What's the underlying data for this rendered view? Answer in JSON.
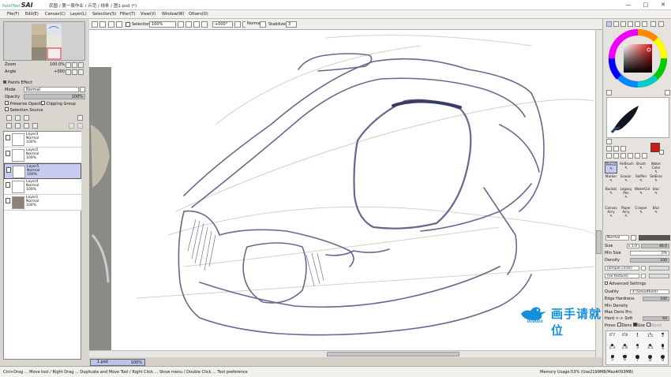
{
  "app": {
    "logo_prefix": "PaintTool",
    "logo_name": "SAI",
    "document_title": "农圆 / 第一周作业 / 示范 / 线条 / 图1.psd (*)"
  },
  "window_controls": [
    "—",
    "□",
    "✕"
  ],
  "menu": [
    {
      "label": "File",
      "key": "F"
    },
    {
      "label": "Edit",
      "key": "E"
    },
    {
      "label": "Canvas",
      "key": "C"
    },
    {
      "label": "Layer",
      "key": "L"
    },
    {
      "label": "Selection",
      "key": "S"
    },
    {
      "label": "Filter",
      "key": "T"
    },
    {
      "label": "View",
      "key": "V"
    },
    {
      "label": "Window",
      "key": "W"
    },
    {
      "label": "Others",
      "key": "O"
    }
  ],
  "toolbar": {
    "selection_label": "Selection",
    "zoom": "100%",
    "rotation": "+000°",
    "blend_mode": "Normal",
    "stabilizer_label": "Stabilizer",
    "stabilizer_value": "3"
  },
  "navigator": {
    "zoom_label": "Zoom",
    "zoom_value": "100.0%",
    "angle_label": "Angle",
    "angle_value": "+000"
  },
  "layer_panel": {
    "paper_effects": "Paints Effect",
    "mode_label": "Mode",
    "mode_value": "Normal",
    "opacity_label": "Opacity",
    "opacity_value": "100%",
    "preserve_opacity": "Preserve Opacity",
    "clipping_group": "Clipping Group",
    "selection_source": "Selection Source",
    "layers": [
      {
        "name": "Layer3",
        "mode": "Normal",
        "opacity": "100%",
        "selected": false
      },
      {
        "name": "Layer2",
        "mode": "Normal",
        "opacity": "100%",
        "selected": false
      },
      {
        "name": "Layer5",
        "mode": "Normal",
        "opacity": "100%",
        "selected": true
      },
      {
        "name": "Layer4",
        "mode": "Normal",
        "opacity": "100%",
        "selected": false
      },
      {
        "name": "Layer1",
        "mode": "Normal",
        "opacity": "100%",
        "selected": false
      }
    ]
  },
  "document_tab": {
    "name": "1.psd",
    "zoom": "100%"
  },
  "right_panel": {
    "current_color": "#c81e14",
    "tools": [
      {
        "label": "Pencil",
        "selected": true
      },
      {
        "label": "AirBrush",
        "selected": false
      },
      {
        "label": "Brush",
        "selected": false
      },
      {
        "label": "Water Color",
        "selected": false
      },
      {
        "label": "Marker",
        "selected": false
      },
      {
        "label": "Eraser",
        "selected": false
      },
      {
        "label": "SelPen",
        "selected": false
      },
      {
        "label": "SelEras",
        "selected": false
      },
      {
        "label": "Bucket",
        "selected": false
      },
      {
        "label": "Legacy Pen",
        "selected": false
      },
      {
        "label": "WaterCol",
        "selected": false
      },
      {
        "label": "blur",
        "selected": false
      },
      {
        "label": "Canvas Acry",
        "selected": false
      },
      {
        "label": "Paper Acry",
        "selected": false
      },
      {
        "label": "Crayon",
        "selected": false
      },
      {
        "label": "Blur",
        "selected": false
      }
    ],
    "brush_mode": "Normal",
    "size_label": "Size",
    "size_mult": "x 1.0",
    "size_value": "46.0",
    "min_size_label": "Min Size",
    "min_size_value": "0%",
    "density_label": "Density",
    "density_value": "100",
    "shape": "(simple circle)",
    "texture": "(no texture)",
    "advanced_label": "Advanced Settings",
    "quality_label": "Quality",
    "quality_value": "4 (Smoothest)",
    "edge_label": "Edge Hardness",
    "edge_value": "100",
    "min_density_label": "Min Density",
    "max_dens_label": "Max Dens Prs.",
    "hard_soft_label": "Hard <-> Soft",
    "hard_soft_value": "94",
    "press_label": "Press:",
    "dens_label": "Dens",
    "size2_label": "Size",
    "blend_label": "Blend",
    "brush_sizes": [
      "0.7",
      "0.8",
      "1",
      "1.5",
      "2",
      "2.3",
      "2.6",
      "3",
      "3.5",
      "4",
      "5",
      "6",
      "7",
      "8",
      "9"
    ]
  },
  "status": {
    "hint": "Ctrl+Drag ... Move tool / Right Drag ... Duplicate and Move Tool / Right Click ... Show menu / Double Click ... Tool preference",
    "memory": "Memory Usage:53% (Use2199MB/Max4093MB)"
  },
  "watermark": {
    "text": "画手请就位",
    "sub": "DUDUDU"
  }
}
